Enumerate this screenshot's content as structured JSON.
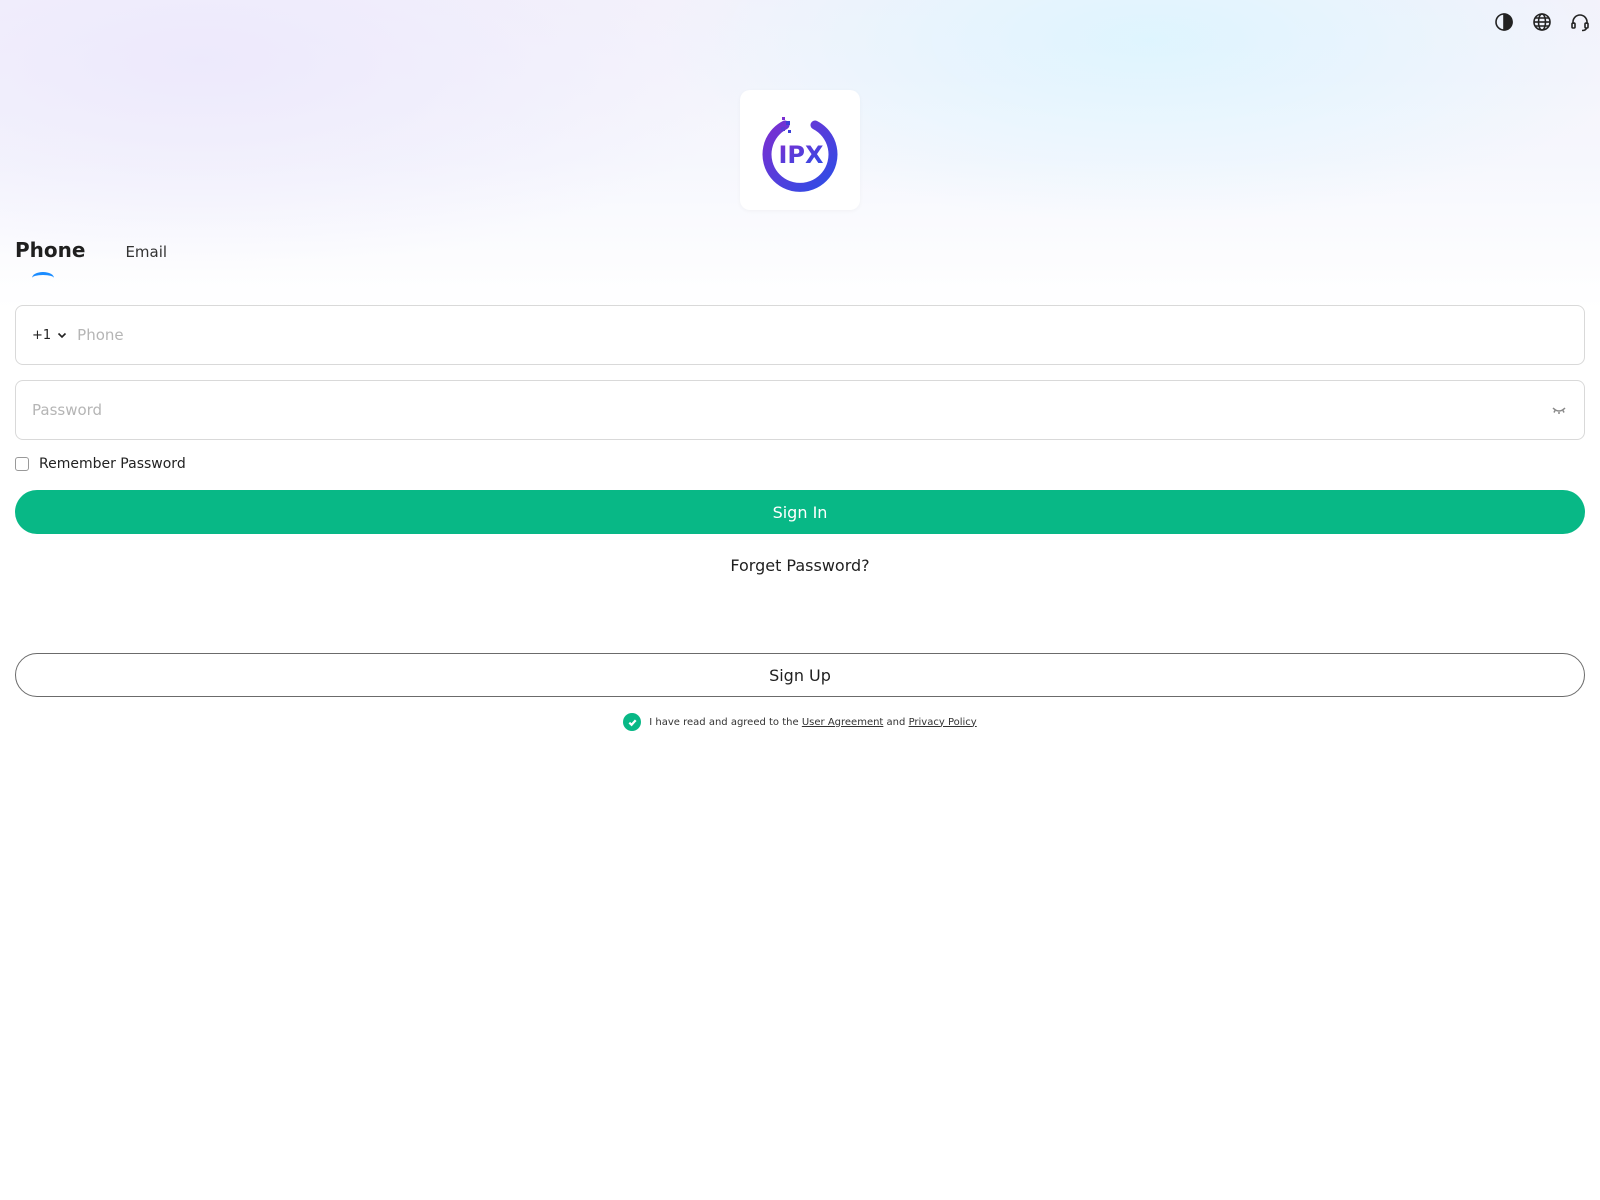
{
  "header": {
    "icons": [
      "contrast-icon",
      "globe-icon",
      "headset-icon"
    ]
  },
  "logo": {
    "text": "IPX",
    "colors": [
      "#2c4de6",
      "#7b2fd1"
    ]
  },
  "tabs": [
    {
      "label": "Phone",
      "active": true
    },
    {
      "label": "Email",
      "active": false
    }
  ],
  "form": {
    "country_code": "+1",
    "phone_placeholder": "Phone",
    "password_placeholder": "Password",
    "remember_label": "Remember Password",
    "signin_label": "Sign In",
    "forget_label": "Forget Password?",
    "signup_label": "Sign Up"
  },
  "agreement": {
    "prefix": "I have read and agreed to the",
    "user_agreement": "User Agreement",
    "and": "and",
    "privacy_policy": "Privacy Policy",
    "checked": true
  },
  "colors": {
    "primary": "#08b886",
    "tab_indicator": "#1a8cff"
  }
}
